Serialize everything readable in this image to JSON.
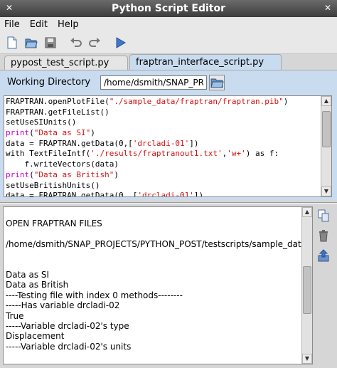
{
  "window": {
    "title": "Python Script Editor"
  },
  "menu": {
    "items": [
      "File",
      "Edit",
      "Help"
    ]
  },
  "toolbar": {
    "icons": [
      "new-file-icon",
      "open-folder-icon",
      "save-icon",
      "undo-icon",
      "redo-icon",
      "run-icon"
    ]
  },
  "tabs": [
    {
      "label": "pypost_test_script.py",
      "active": false
    },
    {
      "label": "fraptran_interface_script.py",
      "active": true
    }
  ],
  "working_directory": {
    "label": "Working Directory",
    "value": "/home/dsmith/SNAP_PRO"
  },
  "editor": {
    "lines": [
      [
        [
          "FRAPTRAN.openPlotFile(",
          ""
        ],
        [
          "\"./sample_data/fraptran/fraptran.pib\"",
          "str"
        ],
        [
          ")",
          ""
        ]
      ],
      [
        [
          "FRAPTRAN.getFileList()",
          ""
        ]
      ],
      [
        [
          "setUseSIUnits()",
          ""
        ]
      ],
      [
        [
          "print",
          "kw"
        ],
        [
          "(",
          ""
        ],
        [
          "\"Data as SI\"",
          "str"
        ],
        [
          ")",
          ""
        ]
      ],
      [
        [
          "data = FRAPTRAN.getData(0,[",
          ""
        ],
        [
          "'drcladi-01'",
          "str"
        ],
        [
          "])",
          ""
        ]
      ],
      [
        [
          "with TextFileIntf(",
          ""
        ],
        [
          "'./results/fraptranout1.txt'",
          "str"
        ],
        [
          ",",
          ""
        ],
        [
          "'w+'",
          "str"
        ],
        [
          ") as f:",
          ""
        ]
      ],
      [
        [
          "    f.writeVectors(data)",
          ""
        ]
      ],
      [
        [
          "print",
          "kw"
        ],
        [
          "(",
          ""
        ],
        [
          "\"Data as British\"",
          "str"
        ],
        [
          ")",
          ""
        ]
      ],
      [
        [
          "setUseBritishUnits()",
          ""
        ]
      ],
      [
        [
          "data = FRAPTRAN.getData(0, [",
          ""
        ],
        [
          "'drcladi-01'",
          "str"
        ],
        [
          "])",
          ""
        ]
      ]
    ],
    "scroll_position": 0.12,
    "scroll_visible_fraction": 0.45
  },
  "console": {
    "lines": [
      "OPEN FRAPTRAN FILES",
      "",
      "/home/dsmith/SNAP_PROJECTS/PYTHON_POST/testscripts/sample_data",
      "",
      "",
      "Data as SI",
      "Data as British",
      "----Testing file with index 0 methods--------",
      "-----Has variable drcladi-02",
      "True",
      "-----Variable drcladi-02's type",
      "Displacement",
      "-----Variable drcladi-02's units",
      ""
    ],
    "scroll_position": 0.55,
    "scroll_visible_fraction": 0.35
  },
  "side_tools": [
    "copy-icon",
    "trash-icon",
    "export-icon"
  ],
  "colors": {
    "string": "#d41111",
    "keyword": "#cc00cc",
    "panel": "#c9dcef",
    "titlebar": "#4a4a4a"
  }
}
